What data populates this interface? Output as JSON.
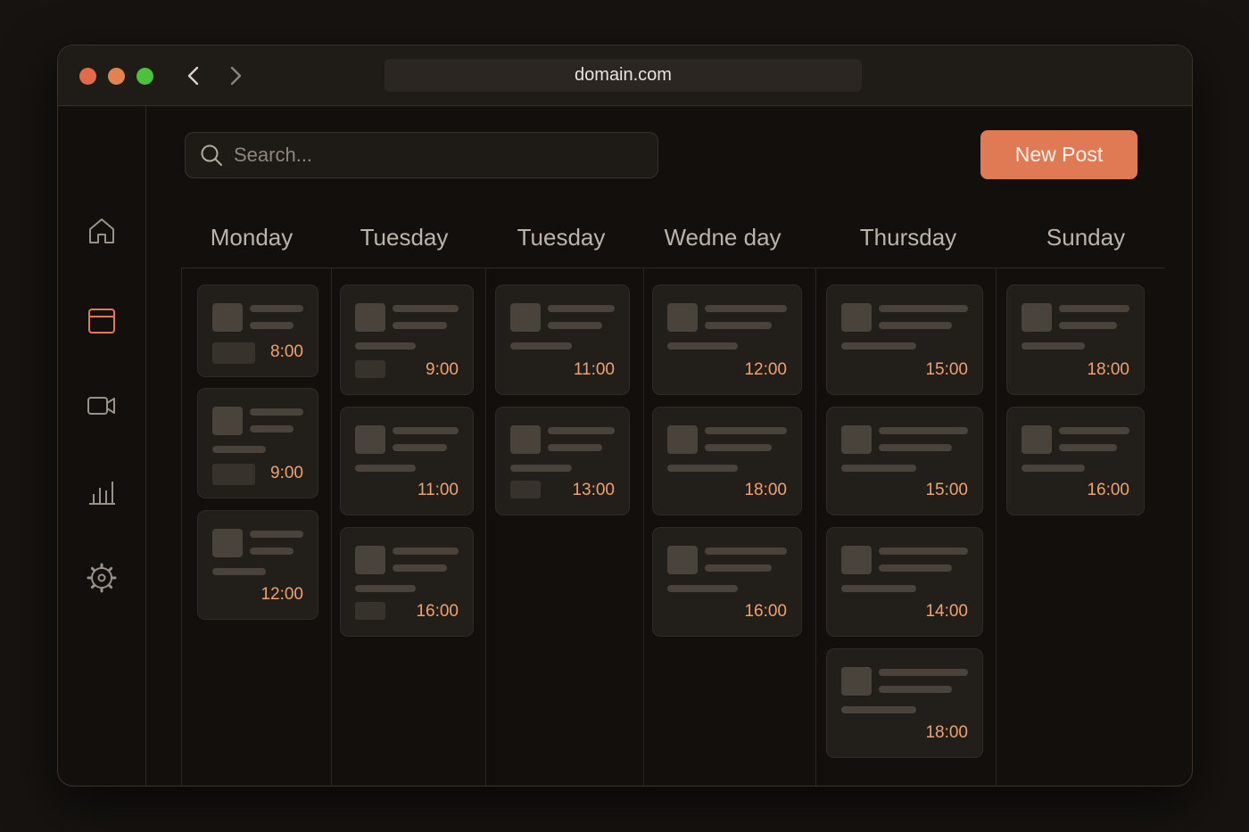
{
  "browser": {
    "url": "domain.com"
  },
  "search": {
    "placeholder": "Search..."
  },
  "toolbar": {
    "new_post_label": "New Post"
  },
  "sidebar": {
    "items": [
      {
        "name": "home-icon",
        "active": false
      },
      {
        "name": "calendar-icon",
        "active": true
      },
      {
        "name": "video-icon",
        "active": false
      },
      {
        "name": "analytics-icon",
        "active": false
      },
      {
        "name": "settings-icon",
        "active": false
      }
    ]
  },
  "colors": {
    "accent": "#e07a55",
    "time": "#f0a26e",
    "background": "#120f0c"
  },
  "days": [
    {
      "label": "Monday",
      "posts": [
        {
          "time": "8:00"
        },
        {
          "time": "9:00"
        },
        {
          "time": "12:00"
        }
      ]
    },
    {
      "label": "Tuesday",
      "posts": [
        {
          "time": "9:00"
        },
        {
          "time": "11:00"
        },
        {
          "time": "16:00"
        }
      ]
    },
    {
      "label": "Tuesday",
      "posts": [
        {
          "time": "11:00"
        },
        {
          "time": "13:00"
        }
      ]
    },
    {
      "label": "Wedne day",
      "posts": [
        {
          "time": "12:00"
        },
        {
          "time": "18:00"
        },
        {
          "time": "16:00"
        }
      ]
    },
    {
      "label": "Thursday",
      "posts": [
        {
          "time": "15:00"
        },
        {
          "time": "15:00"
        },
        {
          "time": "14:00"
        },
        {
          "time": "18:00"
        }
      ]
    },
    {
      "label": "Sunday",
      "posts": [
        {
          "time": "18:00"
        },
        {
          "time": "16:00"
        }
      ]
    }
  ]
}
